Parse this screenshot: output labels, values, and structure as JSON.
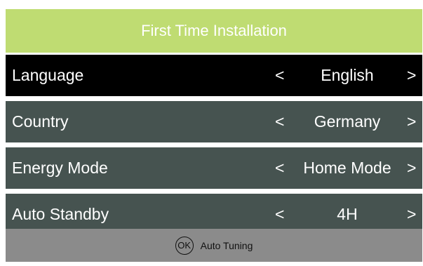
{
  "header": {
    "title": "First Time Installation"
  },
  "menu": {
    "items": [
      {
        "label": "Language",
        "value": "English",
        "selected": true
      },
      {
        "label": "Country",
        "value": "Germany",
        "selected": false
      },
      {
        "label": "Energy Mode",
        "value": "Home Mode",
        "selected": false
      },
      {
        "label": "Auto Standby",
        "value": "4H",
        "selected": false
      }
    ],
    "left_arrow": "<",
    "right_arrow": ">"
  },
  "footer": {
    "ok_key": "OK",
    "hint": "Auto Tuning"
  },
  "colors": {
    "header_bg": "#bfdc72",
    "row_bg": "#465350",
    "selected_bg": "#000000",
    "footer_bg": "#8b8b8b"
  }
}
